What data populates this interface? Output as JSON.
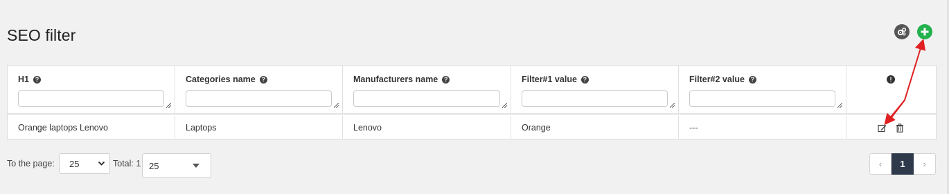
{
  "page": {
    "title": "SEO filter"
  },
  "toolbar": {
    "settings_icon": "gears-icon",
    "add_icon": "plus-circle-icon",
    "add_color": "#22b14c"
  },
  "table": {
    "columns": [
      {
        "label": "H1"
      },
      {
        "label": "Categories name"
      },
      {
        "label": "Manufacturers name"
      },
      {
        "label": "Filter#1 value"
      },
      {
        "label": "Filter#2 value"
      }
    ],
    "help_glyph": "?",
    "info_glyph": "!",
    "rows": [
      {
        "h1": "Orange laptops Lenovo",
        "category": "Laptops",
        "manufacturer": "Lenovo",
        "filter1": "Orange",
        "filter2": "---"
      }
    ]
  },
  "pager": {
    "to_page_label": "To the page:",
    "per_page_value": "25",
    "total_label": "Total: 1",
    "page_size_value": "25",
    "prev_glyph": "‹",
    "current_page": "1",
    "next_glyph": "›"
  },
  "colors": {
    "annotation_arrow": "#e02020",
    "active_page": "#2e3a4b"
  }
}
